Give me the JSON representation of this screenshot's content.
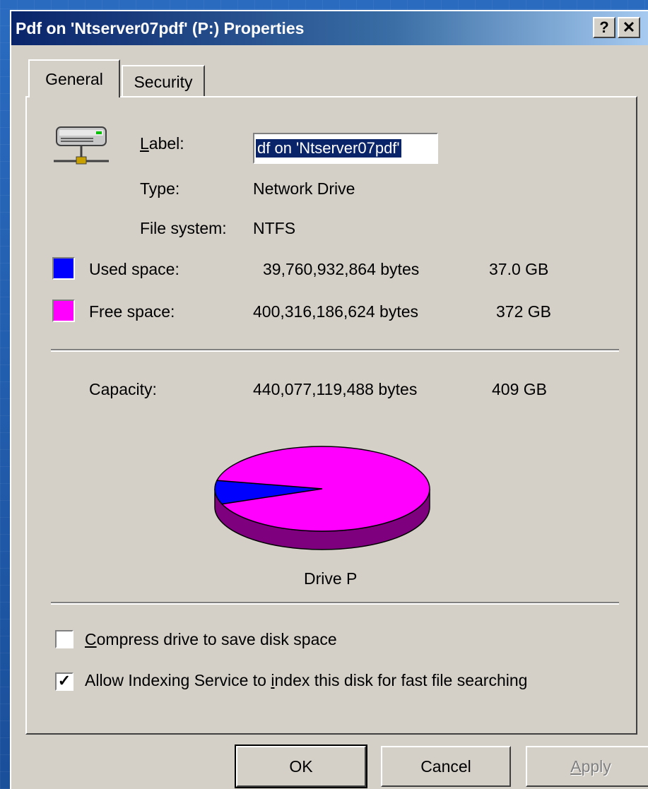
{
  "window": {
    "title": "Pdf on 'Ntserver07pdf' (P:) Properties",
    "help_label": "?",
    "close_label": "✕"
  },
  "tabs": [
    {
      "label": "General",
      "active": true
    },
    {
      "label": "Security",
      "active": false
    }
  ],
  "general": {
    "label_caption": "Label:",
    "label_value": "df on 'Ntserver07pdf'",
    "type_caption": "Type:",
    "type_value": "Network Drive",
    "fs_caption": "File system:",
    "fs_value": "NTFS",
    "used": {
      "caption": "Used space:",
      "bytes": "39,760,932,864 bytes",
      "size": "37.0 GB",
      "color": "#0000ff"
    },
    "free": {
      "caption": "Free space:",
      "bytes": "400,316,186,624 bytes",
      "size": "372 GB",
      "color": "#ff00ff"
    },
    "capacity": {
      "caption": "Capacity:",
      "bytes": "440,077,119,488 bytes",
      "size": "409 GB"
    },
    "drive_caption": "Drive P",
    "compress_label": "Compress drive to save disk space",
    "compress_checked": false,
    "index_label": "Allow Indexing Service to index this disk for fast file searching",
    "index_checked": true
  },
  "buttons": {
    "ok": "OK",
    "cancel": "Cancel",
    "apply": "Apply"
  },
  "icons": {
    "drive": "network-drive-icon"
  },
  "chart_data": {
    "type": "pie",
    "categories": [
      "Used space",
      "Free space"
    ],
    "values": [
      39760932864,
      400316186624
    ],
    "colors": [
      "#0000ff",
      "#ff00ff"
    ],
    "title": "Drive P"
  }
}
